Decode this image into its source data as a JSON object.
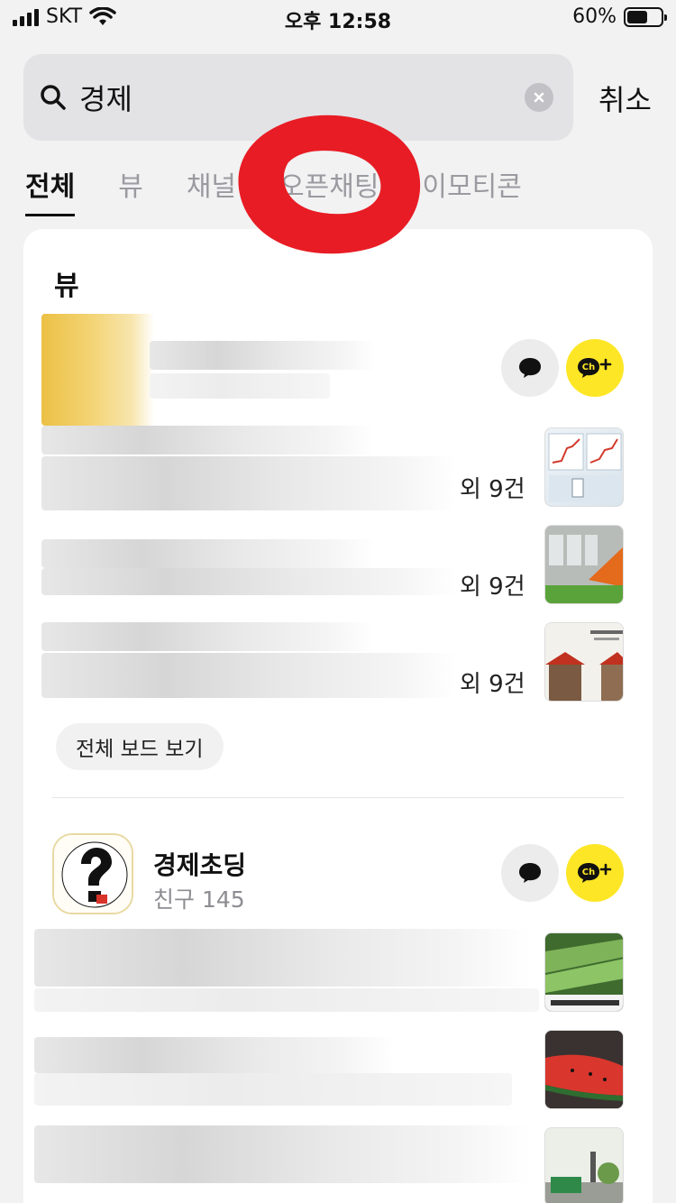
{
  "status_bar": {
    "carrier": "SKT",
    "time": "오후 12:58",
    "battery": "60%",
    "battery_level": 0.6
  },
  "search": {
    "query": "경제",
    "cancel_label": "취소"
  },
  "tabs": [
    {
      "label": "전체"
    },
    {
      "label": "뷰"
    },
    {
      "label": "채널"
    },
    {
      "label": "오픈채팅"
    },
    {
      "label": "이모티콘"
    }
  ],
  "view_section": {
    "title": "뷰",
    "items": [
      {
        "count": "외 9건"
      },
      {
        "count": "외 9건"
      },
      {
        "count": "외 9건"
      }
    ],
    "board_button": "전체 보드 보기"
  },
  "channel": {
    "name": "경제초딩",
    "friends": "친구 145"
  },
  "icons": {
    "chat": "chat-bubble-icon",
    "channel_add": "ch-plus-icon"
  },
  "colors": {
    "accent_yellow": "#fde626",
    "annotation_red": "#e81c24"
  }
}
